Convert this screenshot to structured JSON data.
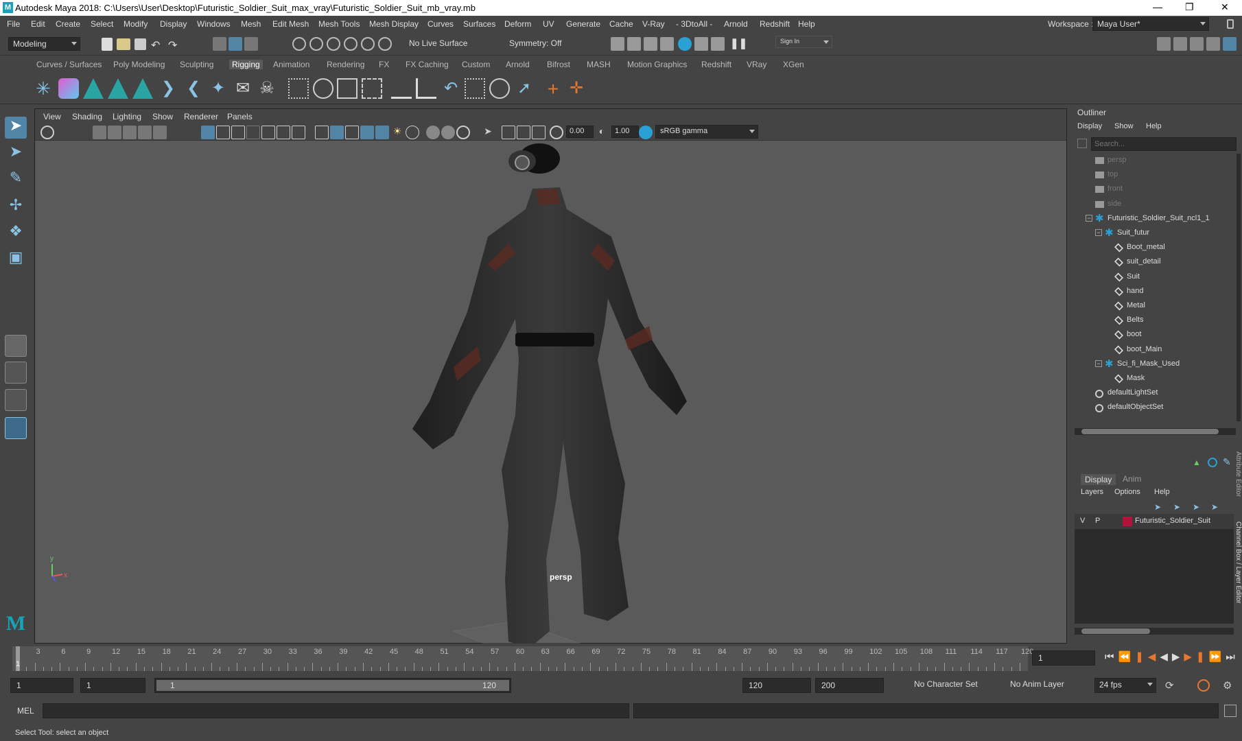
{
  "window": {
    "title": "Autodesk Maya 2018: C:\\Users\\User\\Desktop\\Futuristic_Soldier_Suit_max_vray\\Futuristic_Soldier_Suit_mb_vray.mb",
    "logo": "M",
    "controls": {
      "minimize": "—",
      "maximize": "❐",
      "close": "✕"
    }
  },
  "menu": [
    "File",
    "Edit",
    "Create",
    "Select",
    "Modify",
    "Display",
    "Windows",
    "Mesh",
    "Edit Mesh",
    "Mesh Tools",
    "Mesh Display",
    "Curves",
    "Surfaces",
    "Deform",
    "UV",
    "Generate",
    "Cache",
    "V-Ray",
    "- 3DtoAll -",
    "Arnold",
    "Redshift",
    "Help"
  ],
  "workspace": {
    "label": "Workspace :",
    "value": "Maya User*"
  },
  "status": {
    "mode": "Modeling",
    "live_surface": "No Live Surface",
    "symmetry": "Symmetry: Off",
    "signin": "Sign In"
  },
  "shelf": {
    "tabs": [
      "Curves / Surfaces",
      "Poly Modeling",
      "Sculpting",
      "Rigging",
      "Animation",
      "Rendering",
      "FX",
      "FX Caching",
      "Custom",
      "Arnold",
      "Bifrost",
      "MASH",
      "Motion Graphics",
      "Redshift",
      "VRay",
      "XGen"
    ],
    "active_tab": "Rigging"
  },
  "viewport": {
    "menu": [
      "View",
      "Shading",
      "Lighting",
      "Show",
      "Renderer",
      "Panels"
    ],
    "exposure": "0.00",
    "gamma": "1.00",
    "color_space": "sRGB gamma",
    "camera_label": "persp",
    "axis_x": "x",
    "axis_y": "y"
  },
  "outliner": {
    "title": "Outliner",
    "menu": [
      "Display",
      "Show",
      "Help"
    ],
    "search_placeholder": "Search...",
    "items": [
      {
        "label": "persp",
        "type": "camera",
        "depth": 0,
        "dim": true
      },
      {
        "label": "top",
        "type": "camera",
        "depth": 0,
        "dim": true
      },
      {
        "label": "front",
        "type": "camera",
        "depth": 0,
        "dim": true
      },
      {
        "label": "side",
        "type": "camera",
        "depth": 0,
        "dim": true
      },
      {
        "label": "Futuristic_Soldier_Suit_ncl1_1",
        "type": "group",
        "depth": 0,
        "dim": false,
        "expand": "−"
      },
      {
        "label": "Suit_futur",
        "type": "group",
        "depth": 1,
        "dim": false,
        "expand": "−"
      },
      {
        "label": "Boot_metal",
        "type": "mesh",
        "depth": 2,
        "dim": false
      },
      {
        "label": "suit_detail",
        "type": "mesh",
        "depth": 2,
        "dim": false
      },
      {
        "label": "Suit",
        "type": "mesh",
        "depth": 2,
        "dim": false
      },
      {
        "label": "hand",
        "type": "mesh",
        "depth": 2,
        "dim": false
      },
      {
        "label": "Metal",
        "type": "mesh",
        "depth": 2,
        "dim": false
      },
      {
        "label": "Belts",
        "type": "mesh",
        "depth": 2,
        "dim": false
      },
      {
        "label": "boot",
        "type": "mesh",
        "depth": 2,
        "dim": false
      },
      {
        "label": "boot_Main",
        "type": "mesh",
        "depth": 2,
        "dim": false
      },
      {
        "label": "Sci_fi_Mask_Used",
        "type": "group",
        "depth": 1,
        "dim": false,
        "expand": "−"
      },
      {
        "label": "Mask",
        "type": "mesh",
        "depth": 2,
        "dim": false
      },
      {
        "label": "defaultLightSet",
        "type": "set",
        "depth": 0,
        "dim": false
      },
      {
        "label": "defaultObjectSet",
        "type": "set",
        "depth": 0,
        "dim": false
      }
    ]
  },
  "layer_editor": {
    "tabs": [
      "Display",
      "Anim"
    ],
    "active_tab": "Display",
    "menu": [
      "Layers",
      "Options",
      "Help"
    ],
    "layers": [
      {
        "v": "V",
        "p": "P",
        "color": "#b3123a",
        "name": "Futuristic_Soldier_Suit"
      }
    ],
    "side_tabs": [
      "Attribute Editor",
      "Channel Box / Layer Editor"
    ]
  },
  "timeline": {
    "ticks": [
      3,
      6,
      9,
      12,
      15,
      18,
      21,
      24,
      27,
      30,
      33,
      36,
      39,
      42,
      45,
      48,
      51,
      54,
      57,
      60,
      63,
      66,
      69,
      72,
      75,
      78,
      81,
      84,
      87,
      90,
      93,
      96,
      99,
      102,
      105,
      108,
      111,
      114,
      117,
      120
    ],
    "current_frame": "1",
    "current_frame_field": "1"
  },
  "range": {
    "start": "1",
    "playback_start": "1",
    "slider_start": "1",
    "slider_end": "120",
    "playback_end": "120",
    "end": "200",
    "character_set": "No Character Set",
    "anim_layer": "No Anim Layer",
    "fps": "24 fps"
  },
  "cmd": {
    "lang": "MEL"
  },
  "help": {
    "text": "Select Tool: select an object"
  },
  "colors": {
    "accent": "#5285a6",
    "active_tool": "#5285a6",
    "maya_logo": "#16a3b8",
    "layer_color": "#b3123a"
  }
}
